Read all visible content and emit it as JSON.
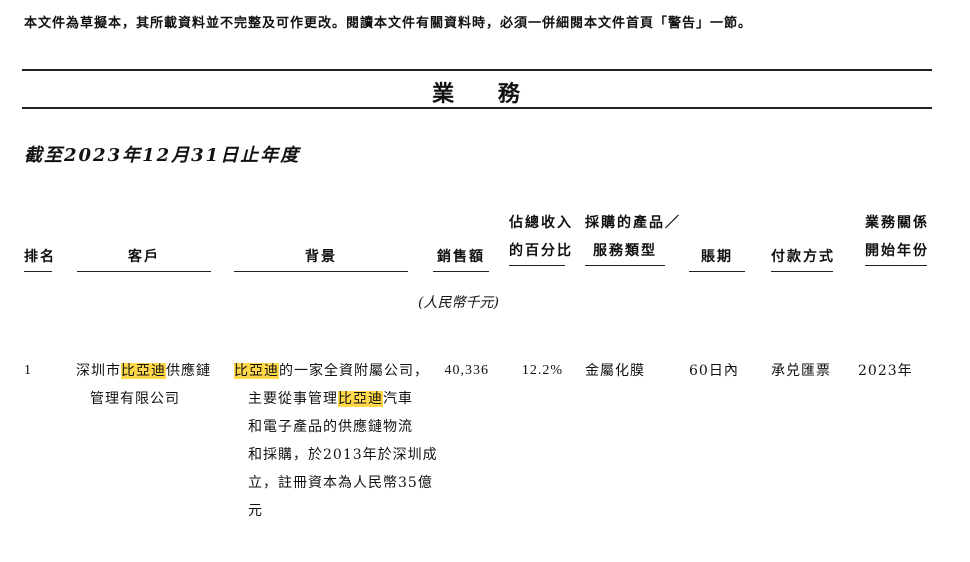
{
  "notice": "本文件為草擬本，其所載資料並不完整及可作更改。閱讀本文件有關資料時，必須一併細閱本文件首頁「警告」一節。",
  "section_title": "業 務",
  "period": "截至2023年12月31日止年度",
  "headers": {
    "rank": "排名",
    "customer": "客戶",
    "background": "背景",
    "sales": "銷售額",
    "pct_line1": "佔總收入",
    "pct_line2": "的百分比",
    "product_line1": "採購的產品／",
    "product_line2": "服務類型",
    "credit": "賬期",
    "payment": "付款方式",
    "start_line1": "業務關係",
    "start_line2": "開始年份"
  },
  "unit": "(人民幣千元)",
  "row": {
    "rank": "1",
    "customer_pre": "深圳市",
    "customer_hl": "比亞迪",
    "customer_post": "供應鏈",
    "customer_line2": "管理有限公司",
    "bg_l1_hl": "比亞迪",
    "bg_l1_post": "的一家全資附屬公司，",
    "bg_l2_pre": "主要從事管理",
    "bg_l2_hl": "比亞迪",
    "bg_l2_post": "汽車",
    "bg_l3": "和電子產品的供應鏈物流",
    "bg_l4": "和採購，於2013年於深圳成",
    "bg_l5": "立，註冊資本為人民幣35億",
    "bg_l6": "元",
    "sales": "40,336",
    "pct": "12.2%",
    "product": "金屬化膜",
    "credit": "60日內",
    "payment": "承兑匯票",
    "start": "2023年"
  },
  "colors": {
    "highlight": "#ffd84a",
    "text": "#111111",
    "rule": "#222222"
  }
}
